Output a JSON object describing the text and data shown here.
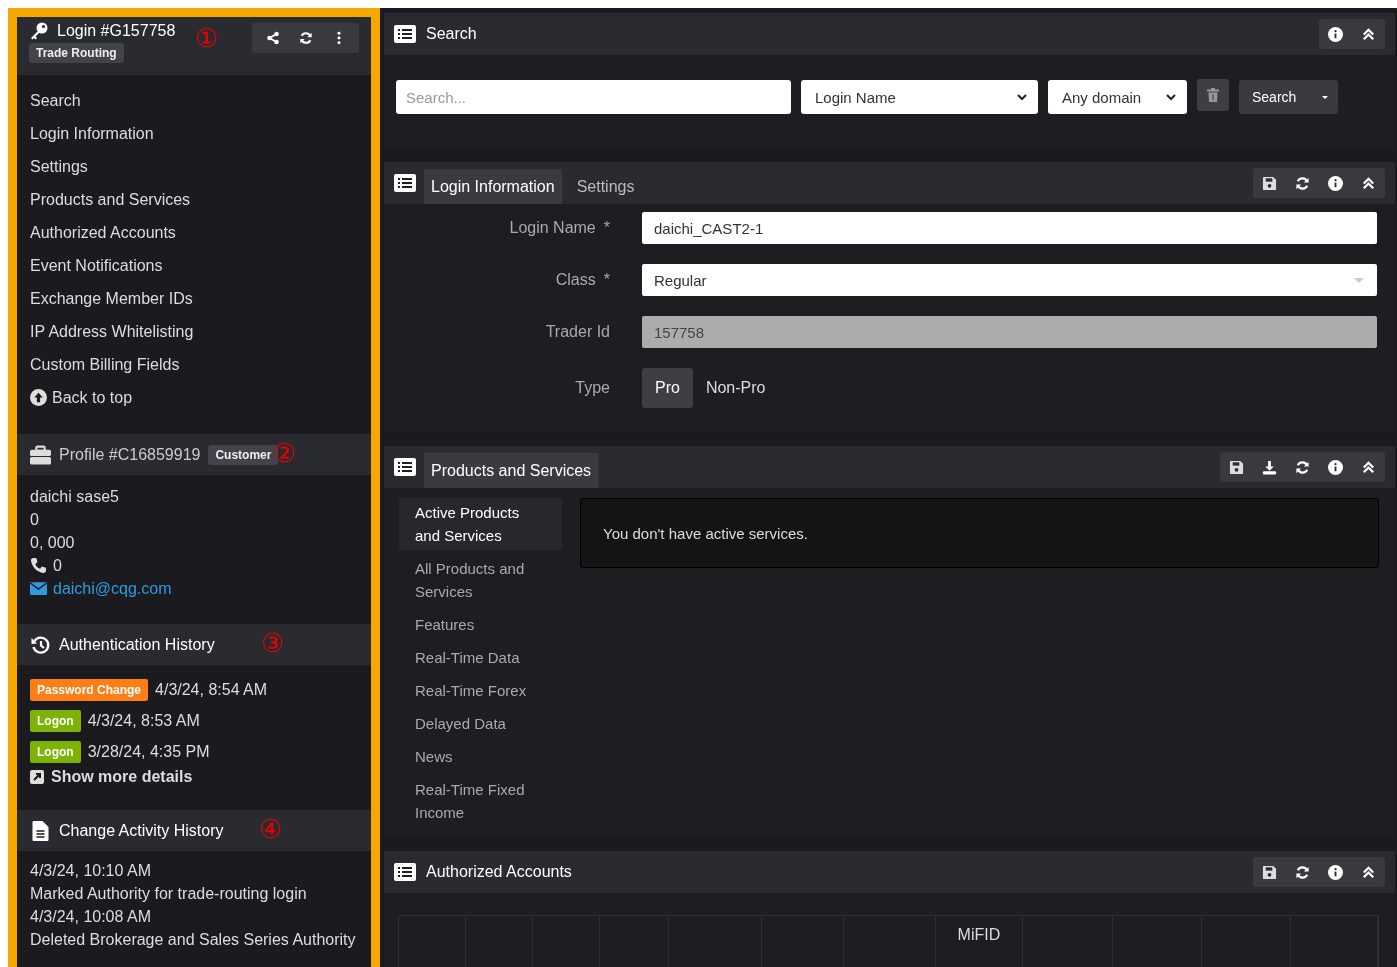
{
  "sidebar": {
    "header": {
      "title": "Login #G157758",
      "badge": "Trade Routing",
      "callout": "①",
      "actions": [
        {
          "kind": "share"
        },
        {
          "kind": "refresh"
        },
        {
          "kind": "more"
        }
      ]
    },
    "nav": [
      {
        "label": "Search",
        "kind": "link"
      },
      {
        "label": "Login Information",
        "kind": "link"
      },
      {
        "label": "Settings",
        "kind": "link"
      },
      {
        "label": "Products and Services",
        "kind": "link"
      },
      {
        "label": "Authorized Accounts",
        "kind": "link"
      },
      {
        "label": "Event Notifications",
        "kind": "link"
      },
      {
        "label": "Exchange Member IDs",
        "kind": "link"
      },
      {
        "label": "IP Address Whitelisting",
        "kind": "link"
      },
      {
        "label": "Custom Billing Fields",
        "kind": "link"
      },
      {
        "label": "Back to top",
        "kind": "top"
      }
    ],
    "profile": {
      "title": "Profile #C16859919",
      "badge": "Customer",
      "callout": "②",
      "lines": [
        {
          "kind": "text",
          "text": "daichi sase5"
        },
        {
          "kind": "text",
          "text": "0"
        },
        {
          "kind": "text",
          "text": "0, 000"
        },
        {
          "kind": "phone",
          "text": "0"
        },
        {
          "kind": "email",
          "text": "daichi@cqg.com"
        }
      ]
    },
    "auth_history": {
      "title": "Authentication History",
      "callout": "③",
      "events": [
        {
          "tag": "Password Change",
          "color": "#fd7e14",
          "time": "4/3/24, 8:54 AM"
        },
        {
          "tag": "Logon",
          "color": "#7cb305",
          "time": "4/3/24, 8:53 AM"
        },
        {
          "tag": "Logon",
          "color": "#7cb305",
          "time": "3/28/24, 4:35 PM"
        }
      ],
      "more_link": "Show more details"
    },
    "change_history": {
      "title": "Change Activity History",
      "callout": "④",
      "entries": [
        {
          "time": "4/3/24, 10:10 AM",
          "text": "Marked Authority for trade-routing login"
        },
        {
          "time": "4/3/24, 10:08 AM",
          "text": "Deleted Brokerage and Sales Series Authority"
        }
      ]
    }
  },
  "main": {
    "search_panel": {
      "title": "Search",
      "actions": [
        {
          "kind": "info"
        },
        {
          "kind": "collapse"
        }
      ],
      "query": {
        "placeholder": "Search..."
      },
      "field_select": "Login Name",
      "domain_select": "Any domain",
      "search_button": "Search"
    },
    "login_panel": {
      "tabs": [
        {
          "label": "Login Information",
          "selected": true
        },
        {
          "label": "Settings",
          "selected": false
        }
      ],
      "actions": [
        {
          "kind": "save"
        },
        {
          "kind": "refresh"
        },
        {
          "kind": "info"
        },
        {
          "kind": "collapse"
        }
      ],
      "fields": [
        {
          "label": "Login Name",
          "mark": "*",
          "kind": "input",
          "value": "daichi_CAST2-1"
        },
        {
          "label": "Class",
          "mark": "*",
          "kind": "select",
          "value": "Regular"
        },
        {
          "label": "Trader Id",
          "kind": "readonly",
          "value": "157758"
        },
        {
          "label": "Type",
          "kind": "toggle",
          "options": [
            {
              "label": "Pro",
              "selected": true
            },
            {
              "label": "Non-Pro",
              "selected": false
            }
          ]
        }
      ]
    },
    "products_panel": {
      "tabs": [
        {
          "label": "Products and Services",
          "selected": true
        }
      ],
      "actions": [
        {
          "kind": "save"
        },
        {
          "kind": "download"
        },
        {
          "kind": "refresh"
        },
        {
          "kind": "info"
        },
        {
          "kind": "collapse"
        }
      ],
      "categories": [
        {
          "label": "Active Products and Services",
          "selected": true
        },
        {
          "label": "All Products and Services",
          "selected": false
        },
        {
          "label": "Features",
          "selected": false
        },
        {
          "label": "Real-Time Data",
          "selected": false
        },
        {
          "label": "Real-Time Forex",
          "selected": false
        },
        {
          "label": "Delayed Data",
          "selected": false
        },
        {
          "label": "News",
          "selected": false
        },
        {
          "label": "Real-Time Fixed Income",
          "selected": false
        }
      ],
      "message": "You don't have active services."
    },
    "accounts_panel": {
      "title": "Authorized Accounts",
      "actions": [
        {
          "kind": "save"
        },
        {
          "kind": "refresh"
        },
        {
          "kind": "info"
        },
        {
          "kind": "collapse"
        }
      ],
      "columns": [
        {},
        {},
        {},
        {},
        {},
        {},
        {},
        {
          "label": "MiFID"
        },
        {},
        {},
        {},
        {}
      ]
    }
  }
}
